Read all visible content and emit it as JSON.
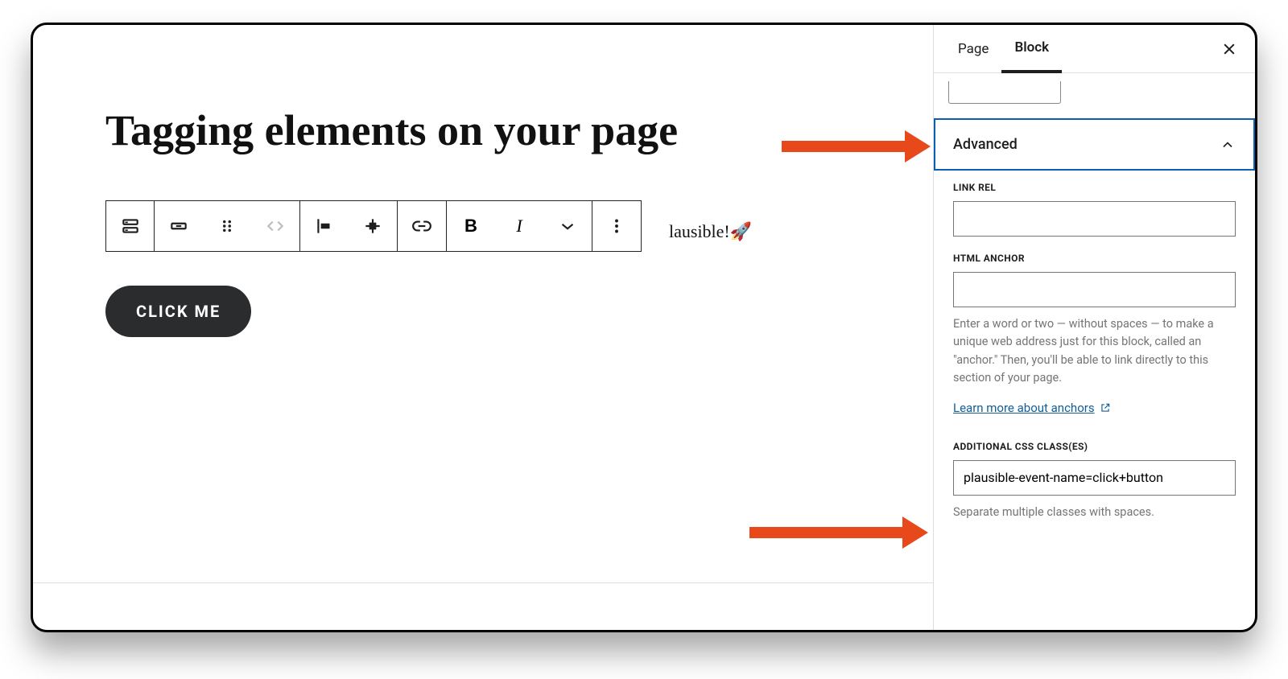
{
  "editor": {
    "title": "Tagging elements on your page",
    "partial_text": "lausible!🚀",
    "button_label": "CLICK ME"
  },
  "toolbar": {
    "icons": {
      "block_type": "block-type-icon",
      "align": "align-icon",
      "drag": "drag-handle-icon",
      "move": "move-arrows-icon",
      "justify_left": "justify-left-icon",
      "justify_center": "justify-center-icon",
      "link": "link-icon",
      "bold": "B",
      "italic": "I",
      "chevron": "chevron-down-icon",
      "more": "more-vertical-icon"
    }
  },
  "sidebar": {
    "tabs": {
      "page": "Page",
      "block": "Block",
      "active": "block"
    },
    "close": "✕",
    "advanced": {
      "title": "Advanced",
      "link_rel": {
        "label": "LINK REL",
        "value": ""
      },
      "html_anchor": {
        "label": "HTML ANCHOR",
        "value": "",
        "help": "Enter a word or two — without spaces — to make a unique web address just for this block, called an \"anchor.\" Then, you'll be able to link directly to this section of your page."
      },
      "learn_more": "Learn more about anchors",
      "css_classes": {
        "label": "ADDITIONAL CSS CLASS(ES)",
        "value": "plausible-event-name=click+button",
        "help": "Separate multiple classes with spaces."
      }
    }
  }
}
